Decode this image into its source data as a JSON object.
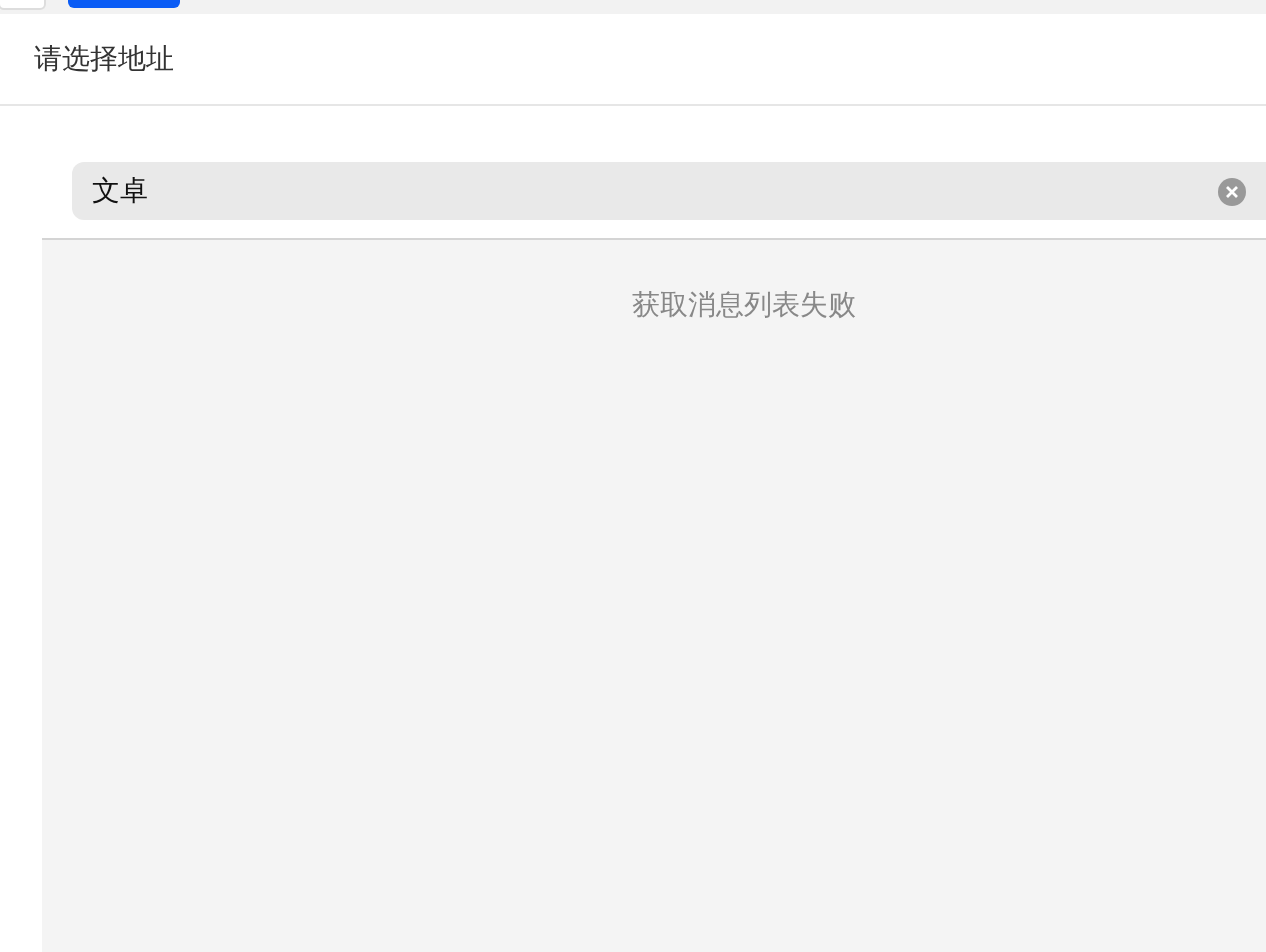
{
  "header": {
    "title": "请选择地址"
  },
  "search": {
    "value": "文卓"
  },
  "list": {
    "message": "获取消息列表失败"
  }
}
